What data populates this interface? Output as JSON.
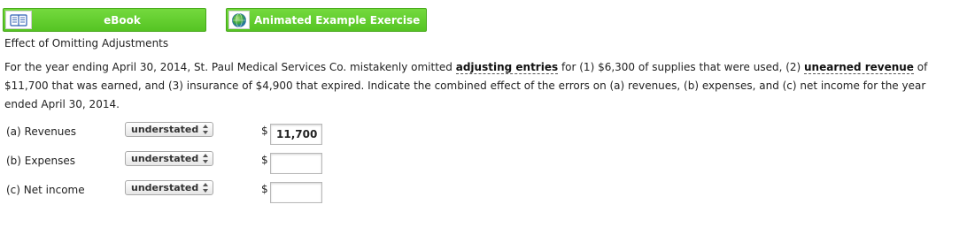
{
  "toolbar": {
    "ebook_label": "eBook",
    "animated_label": "Animated Example Exercise"
  },
  "section_title": "Effect of Omitting Adjustments",
  "question": {
    "part1": "For the year ending April 30, 2014, St. Paul Medical Services Co. mistakenly omitted ",
    "term1": "adjusting entries",
    "part2": " for (1) $6,300 of supplies that were used, (2) ",
    "term2": "unearned revenue",
    "part3": " of $11,700 that was earned, and (3) insurance of $4,900 that expired. Indicate the combined effect of the errors on (a) revenues, (b) expenses, and (c) net income for the year ended April 30, 2014."
  },
  "rows": [
    {
      "label": "(a) Revenues",
      "effect": "understated",
      "currency": "$",
      "amount": "11,700"
    },
    {
      "label": "(b) Expenses",
      "effect": "understated",
      "currency": "$",
      "amount": ""
    },
    {
      "label": "(c) Net income",
      "effect": "understated",
      "currency": "$",
      "amount": ""
    }
  ],
  "colors": {
    "button_green": "#5bc72a",
    "button_border": "#46a81a"
  },
  "icons": {
    "ebook": "book-icon",
    "animated": "globe-icon"
  }
}
